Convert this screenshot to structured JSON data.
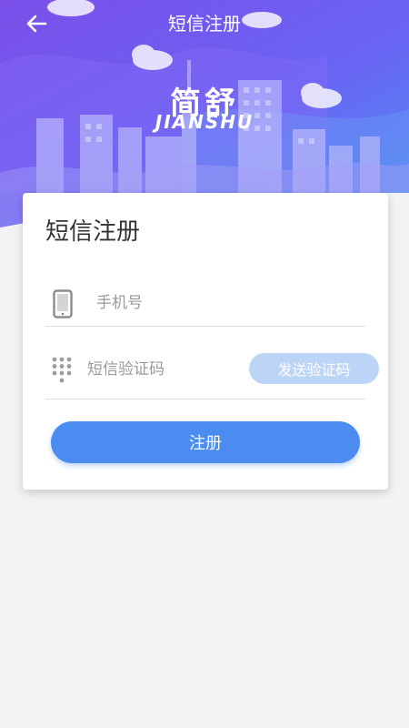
{
  "header": {
    "title": "短信注册",
    "back_icon": "arrow-left-icon",
    "logo_cn": "简舒",
    "logo_en": "JIANSHU"
  },
  "form": {
    "title": "短信注册",
    "phone": {
      "placeholder": "手机号",
      "value": "",
      "icon": "phone-icon"
    },
    "code": {
      "placeholder": "短信验证码",
      "value": "",
      "icon": "keypad-icon"
    },
    "send_code_label": "发送验证码",
    "register_label": "注册"
  },
  "colors": {
    "primary": "#4a8cf0",
    "primary_light": "#bcd4f6",
    "header_purple": "#7a52f0",
    "header_blue": "#4f7ff0",
    "page_bg": "#f2f3f4"
  }
}
